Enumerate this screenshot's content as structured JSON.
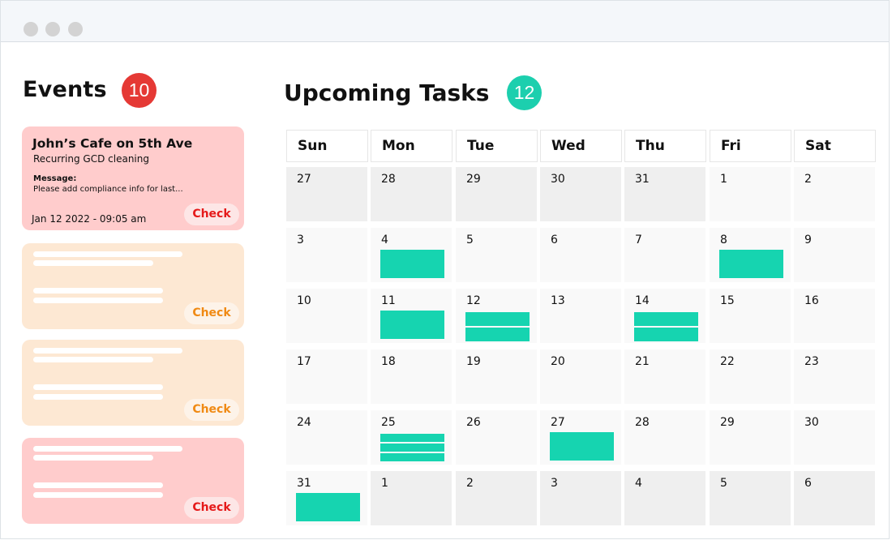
{
  "window": {
    "controls": [
      "close",
      "minimize",
      "maximize"
    ]
  },
  "events": {
    "title": "Events",
    "count": "10",
    "badge_color": "#e53935",
    "cards": [
      {
        "variant": "pink",
        "title": "John’s Cafe on 5th Ave",
        "subtitle": "Recurring GCD cleaning",
        "message_label": "Message:",
        "message": "Please add compliance info for last...",
        "datetime": "Jan 12 2022 - 09:05 am",
        "button": "Check"
      },
      {
        "variant": "peach",
        "placeholder": true,
        "button": "Check"
      },
      {
        "variant": "peach",
        "placeholder": true,
        "button": "Check"
      },
      {
        "variant": "pink",
        "placeholder": true,
        "button": "Check"
      }
    ]
  },
  "tasks": {
    "title": "Upcoming Tasks",
    "count": "12",
    "badge_color": "#1ccfae",
    "task_color": "#16d4b0",
    "days": [
      "Sun",
      "Mon",
      "Tue",
      "Wed",
      "Thu",
      "Fri",
      "Sat"
    ],
    "weeks": [
      [
        {
          "d": "27",
          "other": true,
          "tasks": 0
        },
        {
          "d": "28",
          "other": true,
          "tasks": 0
        },
        {
          "d": "29",
          "other": true,
          "tasks": 0
        },
        {
          "d": "30",
          "other": true,
          "tasks": 0
        },
        {
          "d": "31",
          "other": true,
          "tasks": 0
        },
        {
          "d": "1",
          "tasks": 0
        },
        {
          "d": "2",
          "tasks": 0
        }
      ],
      [
        {
          "d": "3",
          "tasks": 0
        },
        {
          "d": "4",
          "tasks": 1
        },
        {
          "d": "5",
          "tasks": 0
        },
        {
          "d": "6",
          "tasks": 0
        },
        {
          "d": "7",
          "tasks": 0
        },
        {
          "d": "8",
          "tasks": 1
        },
        {
          "d": "9",
          "tasks": 0
        }
      ],
      [
        {
          "d": "10",
          "tasks": 0
        },
        {
          "d": "11",
          "tasks": 1
        },
        {
          "d": "12",
          "tasks": 2
        },
        {
          "d": "13",
          "tasks": 0
        },
        {
          "d": "14",
          "tasks": 2
        },
        {
          "d": "15",
          "tasks": 0
        },
        {
          "d": "16",
          "tasks": 0
        }
      ],
      [
        {
          "d": "17",
          "tasks": 0
        },
        {
          "d": "18",
          "tasks": 0
        },
        {
          "d": "19",
          "tasks": 0
        },
        {
          "d": "20",
          "tasks": 0
        },
        {
          "d": "21",
          "tasks": 0
        },
        {
          "d": "22",
          "tasks": 0
        },
        {
          "d": "23",
          "tasks": 0
        }
      ],
      [
        {
          "d": "24",
          "tasks": 0
        },
        {
          "d": "25",
          "tasks": 3
        },
        {
          "d": "26",
          "tasks": 0
        },
        {
          "d": "27",
          "tasks": 1
        },
        {
          "d": "28",
          "tasks": 0
        },
        {
          "d": "29",
          "tasks": 0
        },
        {
          "d": "30",
          "tasks": 0
        }
      ],
      [
        {
          "d": "31",
          "tasks": 1
        },
        {
          "d": "1",
          "other": true,
          "tasks": 0
        },
        {
          "d": "2",
          "other": true,
          "tasks": 0
        },
        {
          "d": "3",
          "other": true,
          "tasks": 0
        },
        {
          "d": "4",
          "other": true,
          "tasks": 0
        },
        {
          "d": "5",
          "other": true,
          "tasks": 0
        },
        {
          "d": "6",
          "other": true,
          "tasks": 0
        }
      ]
    ]
  }
}
